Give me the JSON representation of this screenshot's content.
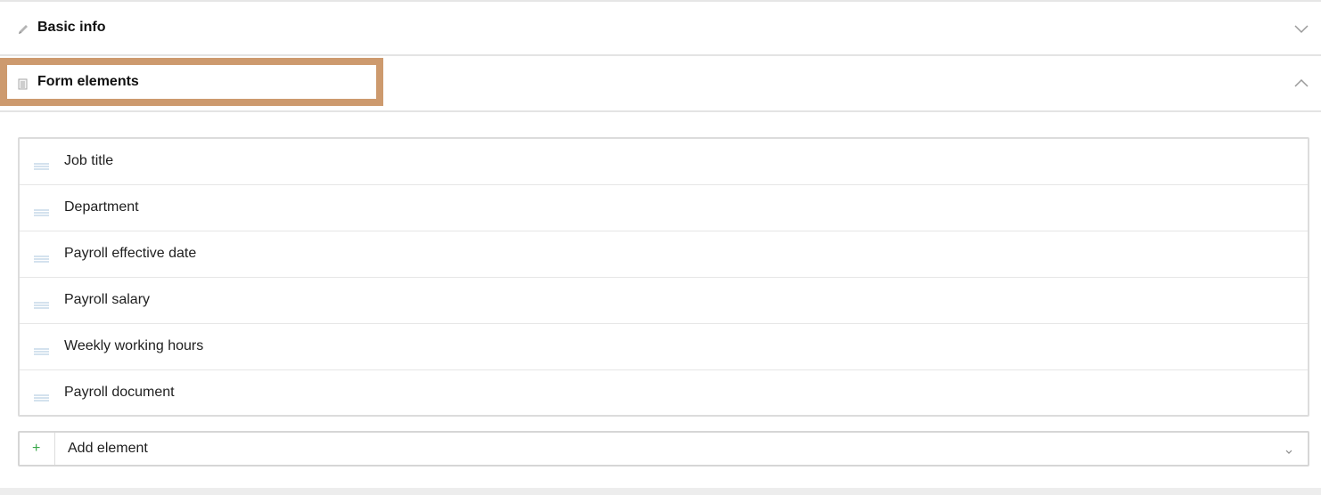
{
  "sections": {
    "basic_info": {
      "title": "Basic info",
      "icon": "pencil-icon",
      "state": "collapsed"
    },
    "form_elements": {
      "title": "Form elements",
      "icon": "document-icon",
      "state": "expanded"
    }
  },
  "elements": [
    {
      "label": "Job title"
    },
    {
      "label": "Department"
    },
    {
      "label": "Payroll effective date"
    },
    {
      "label": "Payroll salary"
    },
    {
      "label": "Weekly working hours"
    },
    {
      "label": "Payroll document"
    }
  ],
  "add_element": {
    "plus": "+",
    "label": "Add element"
  },
  "colors": {
    "highlight": "#cd9a6e",
    "plus": "#3aa84b",
    "drag_handle": "#a9c4dc"
  }
}
